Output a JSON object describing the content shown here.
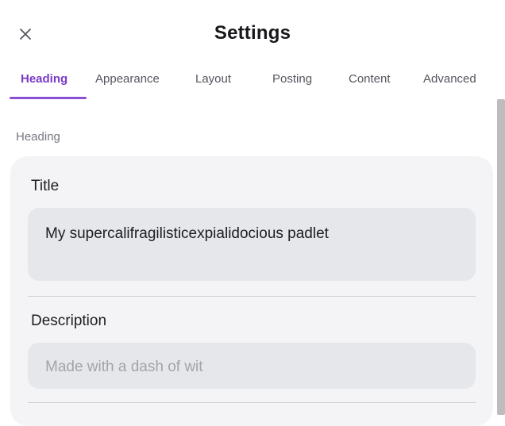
{
  "header": {
    "title": "Settings",
    "close_icon": "close-icon"
  },
  "tabs": [
    {
      "label": "Heading",
      "active": true
    },
    {
      "label": "Appearance",
      "active": false
    },
    {
      "label": "Layout",
      "active": false
    },
    {
      "label": "Posting",
      "active": false
    },
    {
      "label": "Content",
      "active": false
    },
    {
      "label": "Advanced",
      "active": false
    }
  ],
  "section": {
    "label": "Heading"
  },
  "fields": {
    "title": {
      "label": "Title",
      "value": "My supercalifragilisticexpialidocious padlet"
    },
    "description": {
      "label": "Description",
      "placeholder": "Made with a dash of wit"
    }
  },
  "colors": {
    "accent": "#7a39c9",
    "card_background": "#f4f4f6",
    "input_background": "#e6e7ea"
  }
}
